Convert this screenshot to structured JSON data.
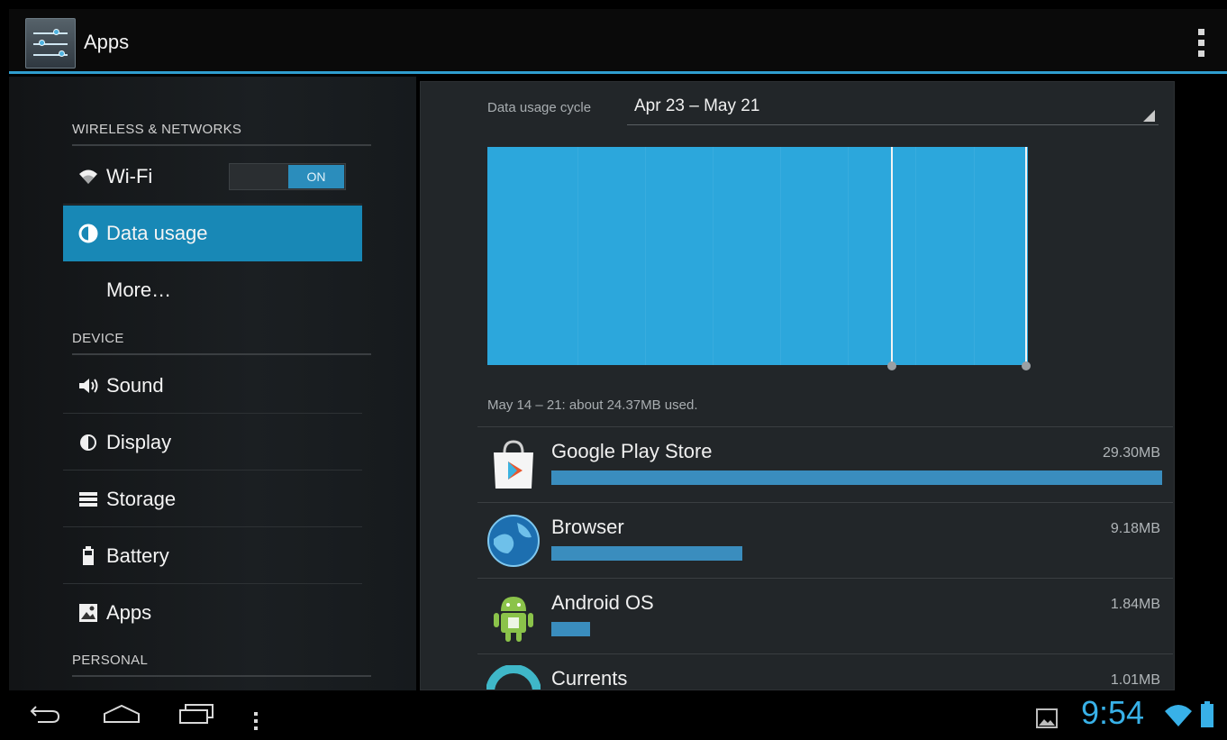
{
  "action_bar": {
    "title": "Apps",
    "icon": "settings-sliders-icon"
  },
  "sidebar": {
    "sections": [
      {
        "header": "WIRELESS & NETWORKS"
      },
      {
        "header": "DEVICE"
      },
      {
        "header": "PERSONAL"
      }
    ],
    "items": [
      {
        "label": "Wi-Fi",
        "icon": "wifi-icon",
        "toggle": "ON"
      },
      {
        "label": "Data usage",
        "icon": "data-usage-icon",
        "selected": true
      },
      {
        "label": "More…",
        "icon": ""
      },
      {
        "label": "Sound",
        "icon": "speaker-icon"
      },
      {
        "label": "Display",
        "icon": "brightness-icon"
      },
      {
        "label": "Storage",
        "icon": "storage-icon"
      },
      {
        "label": "Battery",
        "icon": "battery-icon"
      },
      {
        "label": "Apps",
        "icon": "apps-icon"
      }
    ]
  },
  "main": {
    "cycle_label": "Data usage cycle",
    "cycle_value": "Apr 23 – May 21",
    "summary": "May 14 – 21: about 24.37MB used.",
    "apps": [
      {
        "name": "Google Play Store",
        "size": "29.30MB",
        "fraction": 1.0,
        "icon": "play-store-icon"
      },
      {
        "name": "Browser",
        "size": "9.18MB",
        "fraction": 0.313,
        "icon": "globe-icon"
      },
      {
        "name": "Android OS",
        "size": "1.84MB",
        "fraction": 0.063,
        "icon": "android-icon"
      },
      {
        "name": "Currents",
        "size": "1.01MB",
        "fraction": 0.034,
        "icon": "currents-icon"
      }
    ]
  },
  "status_bar": {
    "time": "9:54"
  },
  "colors": {
    "accent": "#2f9ecf",
    "chart_fill": "#2ca7dc",
    "selected_bg": "#1888b6",
    "clock": "#38b1e8"
  }
}
